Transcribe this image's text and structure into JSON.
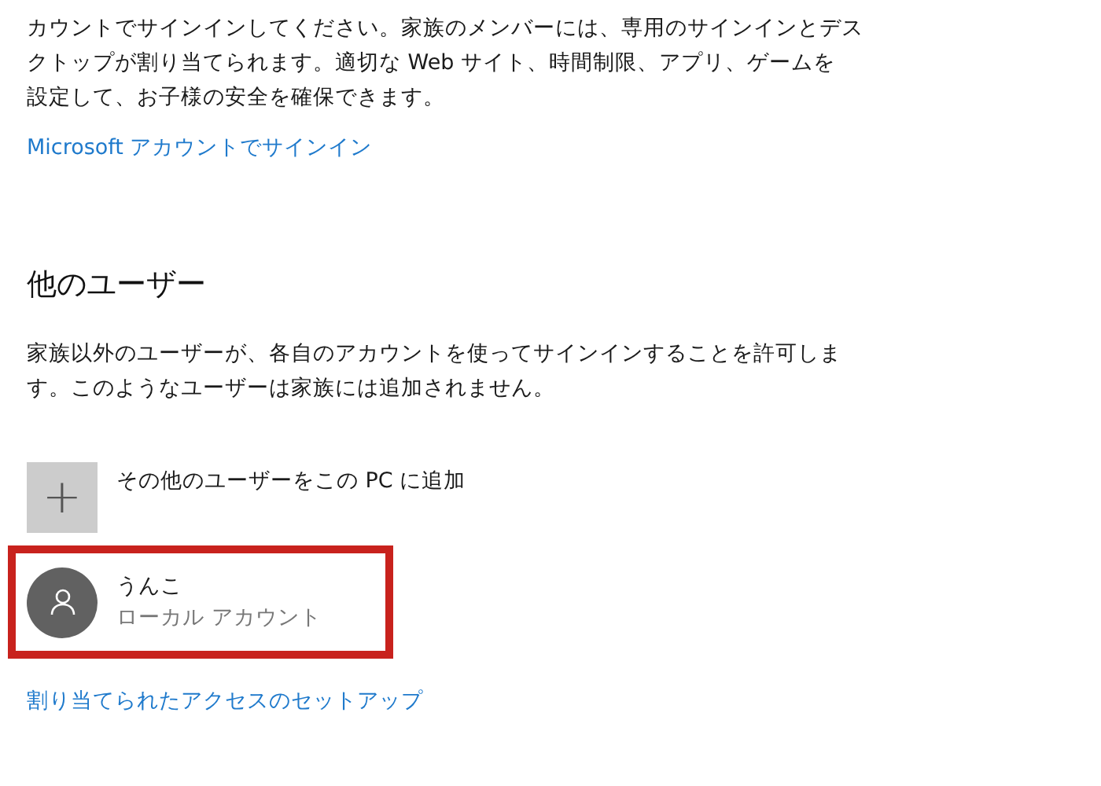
{
  "family_section": {
    "description_lines": [
      "カウントでサインインしてください。家族のメンバーには、専用のサインインとデス",
      "クトップが割り当てられます。適切な Web サイト、時間制限、アプリ、ゲームを",
      "設定して、お子様の安全を確保できます。"
    ],
    "link": "Microsoft アカウントでサインイン"
  },
  "other_users": {
    "heading": "他のユーザー",
    "description_lines": [
      "家族以外のユーザーが、各自のアカウントを使ってサインインすることを許可しま",
      "す。このようなユーザーは家族には追加されません。"
    ],
    "add_user": {
      "icon_char": "+",
      "label": "その他のユーザーをこの PC に追加"
    },
    "accounts": [
      {
        "name": "うんこ",
        "type": "ローカル アカウント",
        "highlighted": true
      }
    ],
    "link": "割り当てられたアクセスのセットアップ"
  }
}
